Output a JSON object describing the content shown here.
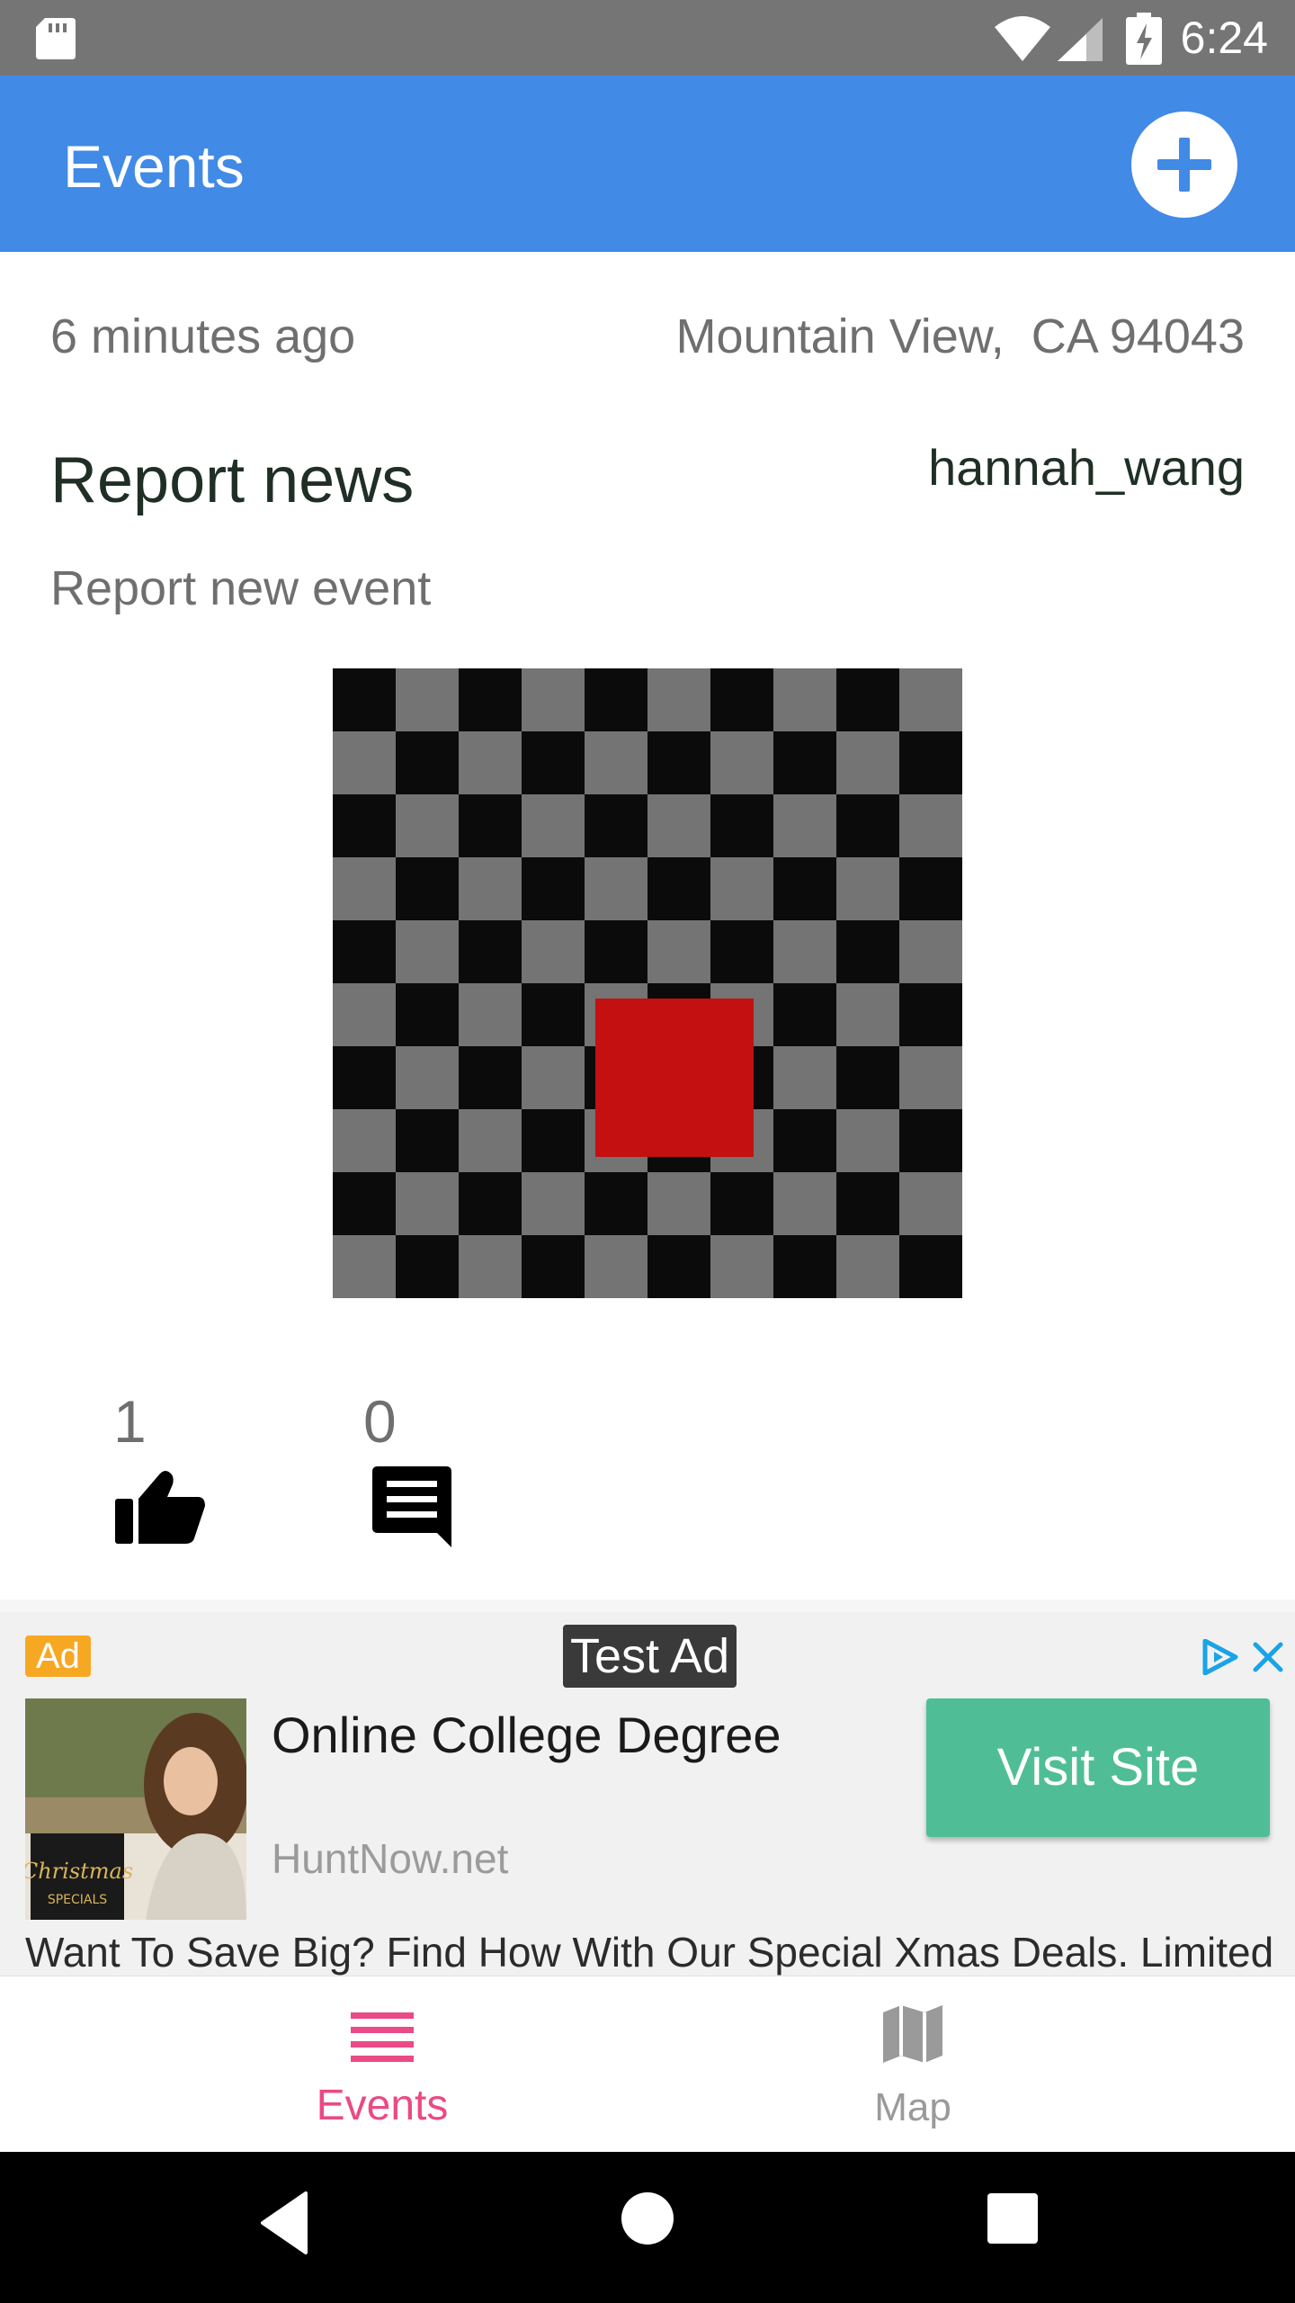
{
  "status_bar": {
    "time": "6:24",
    "icons": [
      "sd-card-icon",
      "wifi-icon",
      "signal-icon",
      "battery-charging-icon"
    ]
  },
  "app_bar": {
    "title": "Events",
    "add_icon": "add-circle-icon",
    "color": "#418ae6"
  },
  "event": {
    "time_ago": "6 minutes ago",
    "location": "Mountain View,  CA 94043",
    "title": "Report news",
    "username": "hannah_wang",
    "description": "Report new event",
    "likes": "1",
    "comments": "0",
    "like_icon": "thumb-up-icon",
    "comment_icon": "comment-icon",
    "image": "checkerboard-with-red-square"
  },
  "ad": {
    "badge": "Ad",
    "test_label": "Test Ad",
    "headline": "Online College Degree",
    "domain": "HuntNow.net",
    "cta": "Visit Site",
    "body": "Want To Save Big? Find How With Our Special Xmas Deals. Limited",
    "image_text": "Christmas SPECIALS",
    "cta_color": "#4fbe96",
    "badge_color": "#f7a823"
  },
  "bottom_nav": {
    "items": [
      {
        "label": "Events",
        "icon": "list-icon",
        "active": true,
        "color": "#ea4a85"
      },
      {
        "label": "Map",
        "icon": "map-icon",
        "active": false,
        "color": "#9a9a9a"
      }
    ]
  },
  "system_nav": {
    "icons": [
      "back-icon",
      "home-icon",
      "recents-icon"
    ]
  }
}
